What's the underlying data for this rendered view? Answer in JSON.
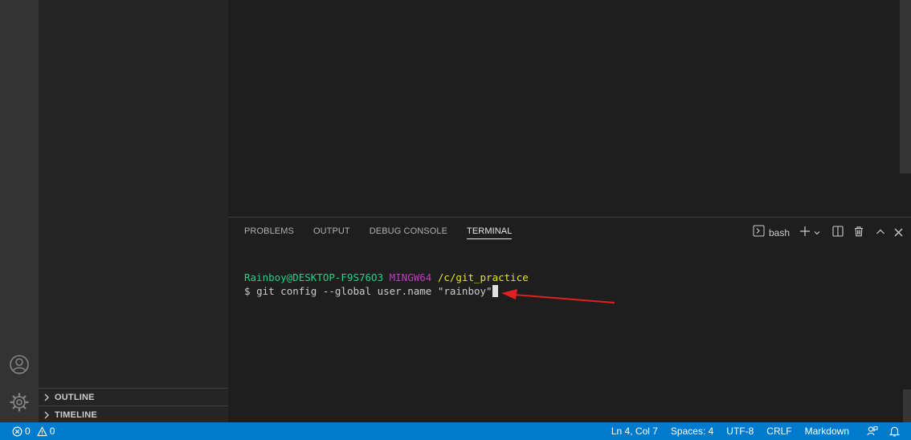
{
  "sidebar": {
    "sections": [
      {
        "label": "OUTLINE"
      },
      {
        "label": "TIMELINE"
      }
    ]
  },
  "panel": {
    "tabs": [
      {
        "label": "PROBLEMS",
        "active": false
      },
      {
        "label": "OUTPUT",
        "active": false
      },
      {
        "label": "DEBUG CONSOLE",
        "active": false
      },
      {
        "label": "TERMINAL",
        "active": true
      }
    ],
    "shell": "bash"
  },
  "terminal": {
    "user_host": "Rainboy@DESKTOP-F9S76O3",
    "env": "MINGW64",
    "path": "/c/git_practice",
    "prompt": "$",
    "command": "git config --global user.name \"rainboy\""
  },
  "status": {
    "errors": "0",
    "warnings": "0",
    "position": "Ln 4, Col 7",
    "spaces": "Spaces: 4",
    "encoding": "UTF-8",
    "eol": "CRLF",
    "language": "Markdown"
  },
  "colors": {
    "statusbar": "#007acc",
    "annotation_arrow": "#e02020",
    "prompt_user": "#23d18b",
    "prompt_env": "#c239c2",
    "prompt_path": "#e5e510"
  }
}
